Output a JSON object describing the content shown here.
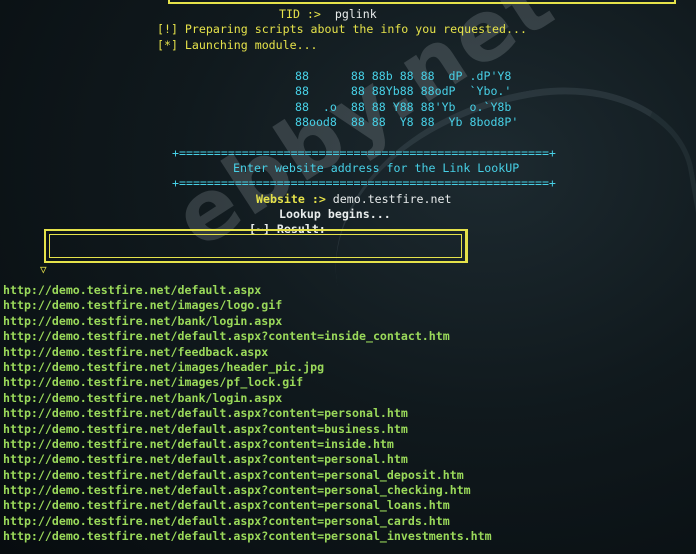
{
  "terminal": {
    "tid_label": "TID :>",
    "tid_value": "pglink",
    "preparing": "[!] Preparing scripts about the info you requested...",
    "launching": "[*] Launching module...",
    "banner": [
      "88      88 88b 88 88  dP .dP'Y8",
      "88      88 88Yb88 88odP  `Ybo.'",
      "88  .o  88 88 Y88 88'Yb  o.`Y8b",
      "88ood8  88 88  Y8 88  Yb 8bod8P'"
    ],
    "separator": "+=====================================================+",
    "heading": "Enter website address for the Link LookUP",
    "website_label": "Website :>",
    "website_value": "demo.testfire.net",
    "lookup": "Lookup begins...",
    "result_label": "[~] Result:",
    "arrow": "▽",
    "watermark": "ebby.net"
  },
  "urls": [
    "http://demo.testfire.net/default.aspx",
    "http://demo.testfire.net/images/logo.gif",
    "http://demo.testfire.net/bank/login.aspx",
    "http://demo.testfire.net/default.aspx?content=inside_contact.htm",
    "http://demo.testfire.net/feedback.aspx",
    "http://demo.testfire.net/images/header_pic.jpg",
    "http://demo.testfire.net/images/pf_lock.gif",
    "http://demo.testfire.net/bank/login.aspx",
    "http://demo.testfire.net/default.aspx?content=personal.htm",
    "http://demo.testfire.net/default.aspx?content=business.htm",
    "http://demo.testfire.net/default.aspx?content=inside.htm",
    "http://demo.testfire.net/default.aspx?content=personal.htm",
    "http://demo.testfire.net/default.aspx?content=personal_deposit.htm",
    "http://demo.testfire.net/default.aspx?content=personal_checking.htm",
    "http://demo.testfire.net/default.aspx?content=personal_loans.htm",
    "http://demo.testfire.net/default.aspx?content=personal_cards.htm",
    "http://demo.testfire.net/default.aspx?content=personal_investments.htm"
  ],
  "colors": {
    "yellow": "#e5e24a",
    "cyan": "#47d0e6",
    "green": "#9ad95a",
    "background": "#0b1216"
  }
}
